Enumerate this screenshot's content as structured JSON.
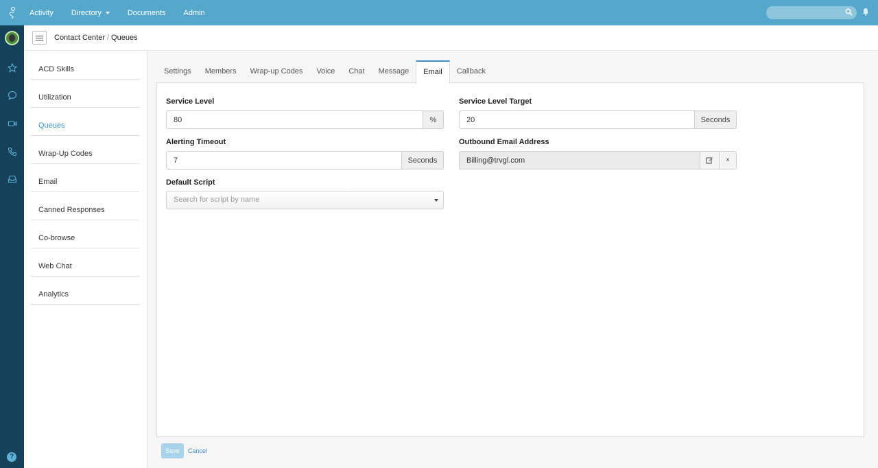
{
  "topnav": {
    "items": [
      {
        "label": "Activity"
      },
      {
        "label": "Directory",
        "has_dropdown": true
      },
      {
        "label": "Documents"
      },
      {
        "label": "Admin"
      }
    ],
    "search_placeholder": ""
  },
  "breadcrumb": {
    "parent": "Contact Center",
    "separator": "/",
    "current": "Queues"
  },
  "sidebar": {
    "items": [
      {
        "label": "ACD Skills"
      },
      {
        "label": "Utilization"
      },
      {
        "label": "Queues",
        "active": true
      },
      {
        "label": "Wrap-Up Codes"
      },
      {
        "label": "Email"
      },
      {
        "label": "Canned Responses"
      },
      {
        "label": "Co-browse"
      },
      {
        "label": "Web Chat"
      },
      {
        "label": "Analytics"
      }
    ]
  },
  "tabs": [
    {
      "label": "Settings"
    },
    {
      "label": "Members"
    },
    {
      "label": "Wrap-up Codes"
    },
    {
      "label": "Voice"
    },
    {
      "label": "Chat"
    },
    {
      "label": "Message"
    },
    {
      "label": "Email",
      "active": true
    },
    {
      "label": "Callback"
    }
  ],
  "form": {
    "service_level": {
      "label": "Service Level",
      "value": "80",
      "unit": "%"
    },
    "service_level_target": {
      "label": "Service Level Target",
      "value": "20",
      "unit": "Seconds"
    },
    "alerting_timeout": {
      "label": "Alerting Timeout",
      "value": "7",
      "unit": "Seconds"
    },
    "outbound_email": {
      "label": "Outbound Email Address",
      "value": "Billing@trvgl.com"
    },
    "default_script": {
      "label": "Default Script",
      "placeholder": "Search for script by name"
    }
  },
  "footer": {
    "save_label": "Save",
    "cancel_label": "Cancel"
  },
  "colors": {
    "topbar": "#55a8cc",
    "rail": "#16415a",
    "accent": "#3e8fc4"
  }
}
